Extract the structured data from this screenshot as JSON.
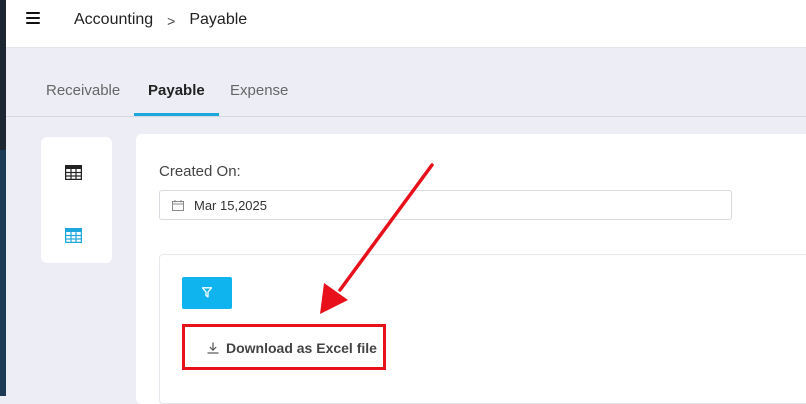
{
  "breadcrumb": {
    "root": "Accounting",
    "separator": ">",
    "current": "Payable"
  },
  "tabs": [
    {
      "label": "Receivable",
      "active": false
    },
    {
      "label": "Payable",
      "active": true
    },
    {
      "label": "Expense",
      "active": false
    }
  ],
  "filters": {
    "created_label": "Created On:",
    "created_value": "Mar 15,2025"
  },
  "actions": {
    "download_label": "Download as Excel file"
  },
  "colors": {
    "accent": "#1ea7dd",
    "filter_button": "#0fb3ee",
    "highlight": "#e8101a"
  },
  "icons": [
    "menu-icon",
    "table-icon",
    "grid-icon",
    "calendar-icon",
    "filter-icon",
    "download-icon",
    "annotation-arrow"
  ]
}
